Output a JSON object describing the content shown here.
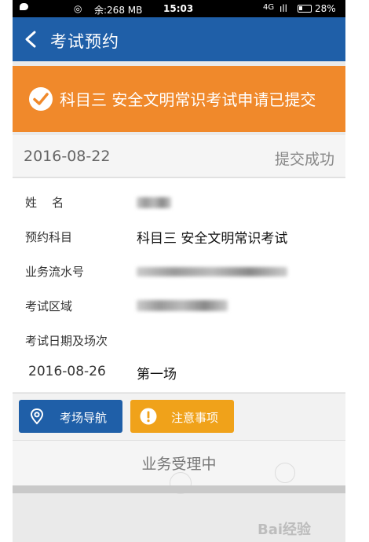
{
  "status_bar": {
    "memory": "余:268 MB",
    "time": "15:03",
    "network": "4G",
    "battery": "28%"
  },
  "header": {
    "title": "考试预约"
  },
  "banner": {
    "message": "科目三 安全文明常识考试申请已提交"
  },
  "summary": {
    "date": "2016-08-22",
    "status": "提交成功"
  },
  "details": {
    "name_label": "姓    名",
    "subject_label": "预约科目",
    "subject_value": "科目三 安全文明常识考试",
    "serial_label": "业务流水号",
    "area_label": "考试区域",
    "schedule_label": "考试日期及场次",
    "exam_date": "2016-08-26",
    "session": "第一场"
  },
  "actions": {
    "navigate_label": "考场导航",
    "notice_label": "注意事项"
  },
  "footer": {
    "processing_text": "业务受理中"
  },
  "watermark": "Bai经验",
  "colors": {
    "primary_blue": "#1f5fa8",
    "banner_orange": "#f0892b",
    "notice_orange": "#f0a21a"
  }
}
